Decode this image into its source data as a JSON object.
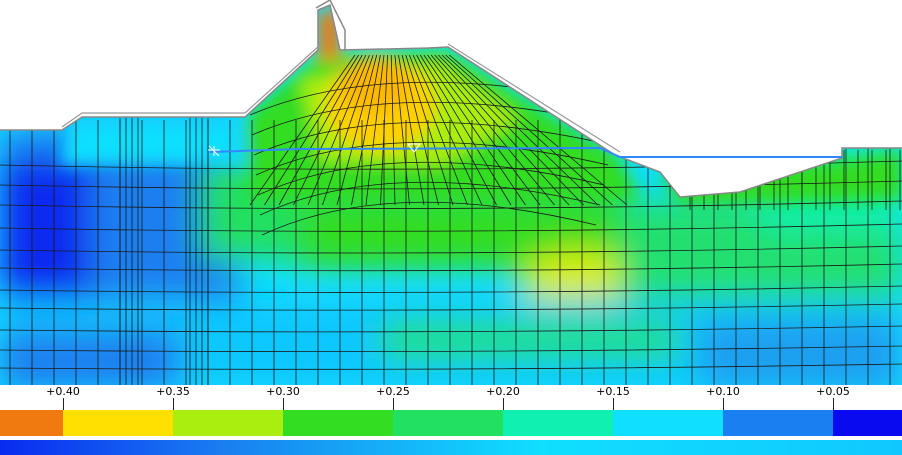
{
  "chart_data": {
    "type": "heatmap",
    "title": "",
    "xlabel": "",
    "ylabel": "",
    "colorbar": {
      "ticks": [
        "+0.40",
        "+0.35",
        "+0.30",
        "+0.25",
        "+0.20",
        "+0.15",
        "+0.10",
        "+0.05"
      ],
      "tick_values": [
        0.4,
        0.35,
        0.3,
        0.25,
        0.2,
        0.15,
        0.1,
        0.05
      ],
      "bins": [
        {
          "range": [
            0.4,
            0.45
          ],
          "color": "#f07a10"
        },
        {
          "range": [
            0.35,
            0.4
          ],
          "color": "#ffe000"
        },
        {
          "range": [
            0.3,
            0.35
          ],
          "color": "#aaee10"
        },
        {
          "range": [
            0.25,
            0.3
          ],
          "color": "#33dd22"
        },
        {
          "range": [
            0.2,
            0.25
          ],
          "color": "#22e060"
        },
        {
          "range": [
            0.15,
            0.2
          ],
          "color": "#10f0b0"
        },
        {
          "range": [
            0.1,
            0.15
          ],
          "color": "#10dfff"
        },
        {
          "range": [
            0.05,
            0.1
          ],
          "color": "#1a7ff0"
        },
        {
          "range": [
            0.0,
            0.05
          ],
          "color": "#0a0af0"
        }
      ]
    },
    "field_description_values": {
      "crest_max": 0.4,
      "dam_core_high": 0.37,
      "left_foundation_low": 0.05,
      "deep_foundation_low": 0.09,
      "foundation_band_mid": 0.22
    }
  },
  "colors": {
    "water_line": "#3388ff",
    "mesh": "#1a1a1a",
    "outline": "#888888"
  }
}
